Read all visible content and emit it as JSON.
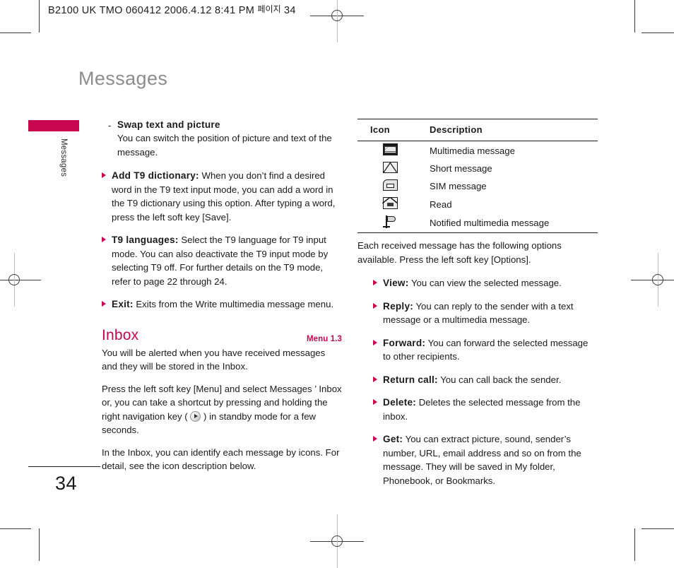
{
  "print_slug": {
    "text": "B2100 UK TMO 060412  2006.4.12 8:41 PM",
    "korean_page_label": "페이지",
    "page_ref": "34"
  },
  "chapter": {
    "title": "Messages",
    "side_tab_label": "Messages",
    "accent_color": "#c8054f"
  },
  "left_column": {
    "sub_item": {
      "dash": "-",
      "heading": "Swap text and picture",
      "body": "You can switch the position of picture and text of the message."
    },
    "bullets": [
      {
        "lead": "Add T9 dictionary:",
        "body": " When you don’t find a desired word in the T9 text input mode, you can add a word in the T9 dictionary using this option. After typing a word, press the left soft key [Save]."
      },
      {
        "lead": "T9 languages:",
        "body": " Select the T9 language for T9 input mode. You can also deactivate the T9 input mode by selecting T9 off. For further details on the T9 mode, refer to page 22 through 24."
      },
      {
        "lead": "Exit:",
        "body": " Exits from the Write multimedia message menu."
      }
    ],
    "section": {
      "heading": "Inbox",
      "menu_ref": "Menu 1.3",
      "paragraphs": [
        "You will be alerted when you have received messages and they will be stored in the Inbox.",
        "In the Inbox, you can identify each message by icons. For detail, see the icon description below."
      ],
      "shortcut_paragraph": {
        "before": "Press the left soft key [Menu] and select Messages ’ Inbox or, you can take a shortcut by pressing  and holding the right navigation key ( ",
        "key_icon": "right-navigation-key",
        "after": " ) in standby mode for a few seconds."
      }
    }
  },
  "right_column": {
    "table": {
      "headers": [
        "Icon",
        "Description"
      ],
      "rows": [
        {
          "icon": "multimedia-message-icon",
          "description": "Multimedia message"
        },
        {
          "icon": "short-message-icon",
          "description": "Short message"
        },
        {
          "icon": "sim-message-icon",
          "description": "SIM message"
        },
        {
          "icon": "read-message-icon",
          "description": "Read"
        },
        {
          "icon": "notified-multimedia-message-icon",
          "description": "Notified multimedia message"
        }
      ]
    },
    "intro": "Each received message has the following options available. Press the left soft key [Options].",
    "options": [
      {
        "lead": "View:",
        "body": " You can view the selected message."
      },
      {
        "lead": "Reply:",
        "body": " You can reply to the sender with a text message or a multimedia message."
      },
      {
        "lead": "Forward:",
        "body": " You can forward the selected message to other recipients."
      },
      {
        "lead": "Return call:",
        "body": " You can call back the sender."
      },
      {
        "lead": "Delete:",
        "body": " Deletes the selected message from  the inbox."
      },
      {
        "lead": "Get:",
        "body": " You can extract picture, sound, sender’s number, URL, email address and so on from the message. They will be saved in My folder, Phonebook, or Bookmarks."
      }
    ]
  },
  "footer": {
    "page_number": "34"
  }
}
